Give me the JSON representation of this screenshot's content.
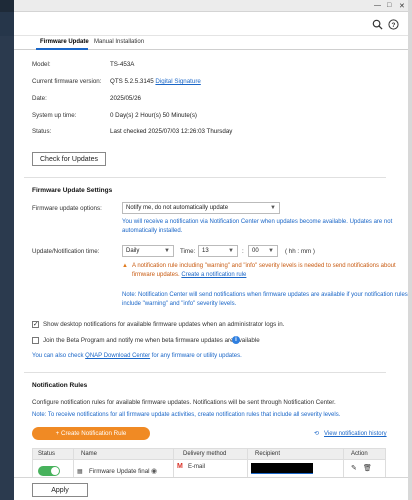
{
  "tabs": [
    "Firmware Update",
    "Manual Installation"
  ],
  "info": {
    "model_label": "Model:",
    "model_value": "TS-453A",
    "firmware_label": "Current firmware version:",
    "firmware_value": "QTS 5.2.5.3145",
    "firmware_link": "Digital Signature",
    "date_label": "Date:",
    "date_value": "2025/05/26",
    "uptime_label": "System up time:",
    "uptime_value": "0 Day(s) 2 Hour(s) 50 Minute(s)",
    "status_label": "Status:",
    "status_value": "Last checked 2025/07/03 12:26:03 Thursday"
  },
  "check_button": "Check for Updates",
  "settings": {
    "title": "Firmware Update Settings",
    "options_label": "Firmware update options:",
    "options_value": "Notify me, do not automatically update",
    "options_note_1": "You will receive a notification via Notification Center when updates become available. Updates are not",
    "options_note_2": "automatically installed.",
    "time_label": "Update/Notification time:",
    "freq_value": "Daily",
    "time_text": "Time:",
    "hour_value": "13",
    "minute_value": "00",
    "time_unit": "( hh : mm )",
    "warn_line_1": "A notification rule including \"warning\" and \"info\" severity levels is needed to send notifications about",
    "warn_line_2_prefix": "firmware updates.",
    "warn_link": "Create a notification rule",
    "nc_note_1": "Note: Notification Center will send notifications when firmware updates are available if your notification rules",
    "nc_note_2": "include \"warning\" and \"info\" severity levels."
  },
  "desktop_notify": "Show desktop notifications for available firmware updates when an administrator logs in.",
  "beta_program": "Join the Beta Program and notify me when beta firmware updates are available",
  "qdc_prefix": "You can also check",
  "qdc_link": "QNAP Download Center",
  "qdc_suffix": "for any firmware or utility updates.",
  "rules": {
    "title": "Notification Rules",
    "desc": "Configure notification rules for available firmware updates. Notifications will be sent through Notification Center.",
    "note": "Note: To receive notifications for all firmware update activities, create notification rules that include all severity levels.",
    "create_button": "+ Create Notification Rule",
    "view_history": "View notification history",
    "columns": [
      "Status",
      "Name",
      "Delivery method",
      "Recipient",
      "Action"
    ],
    "row_name": "Firmware Update final",
    "row_delivery": "E-mail"
  },
  "apply_button": "Apply",
  "colors": {
    "accent": "#1a66c7",
    "orange": "#f08a24",
    "toggle_on": "#47b25c"
  }
}
